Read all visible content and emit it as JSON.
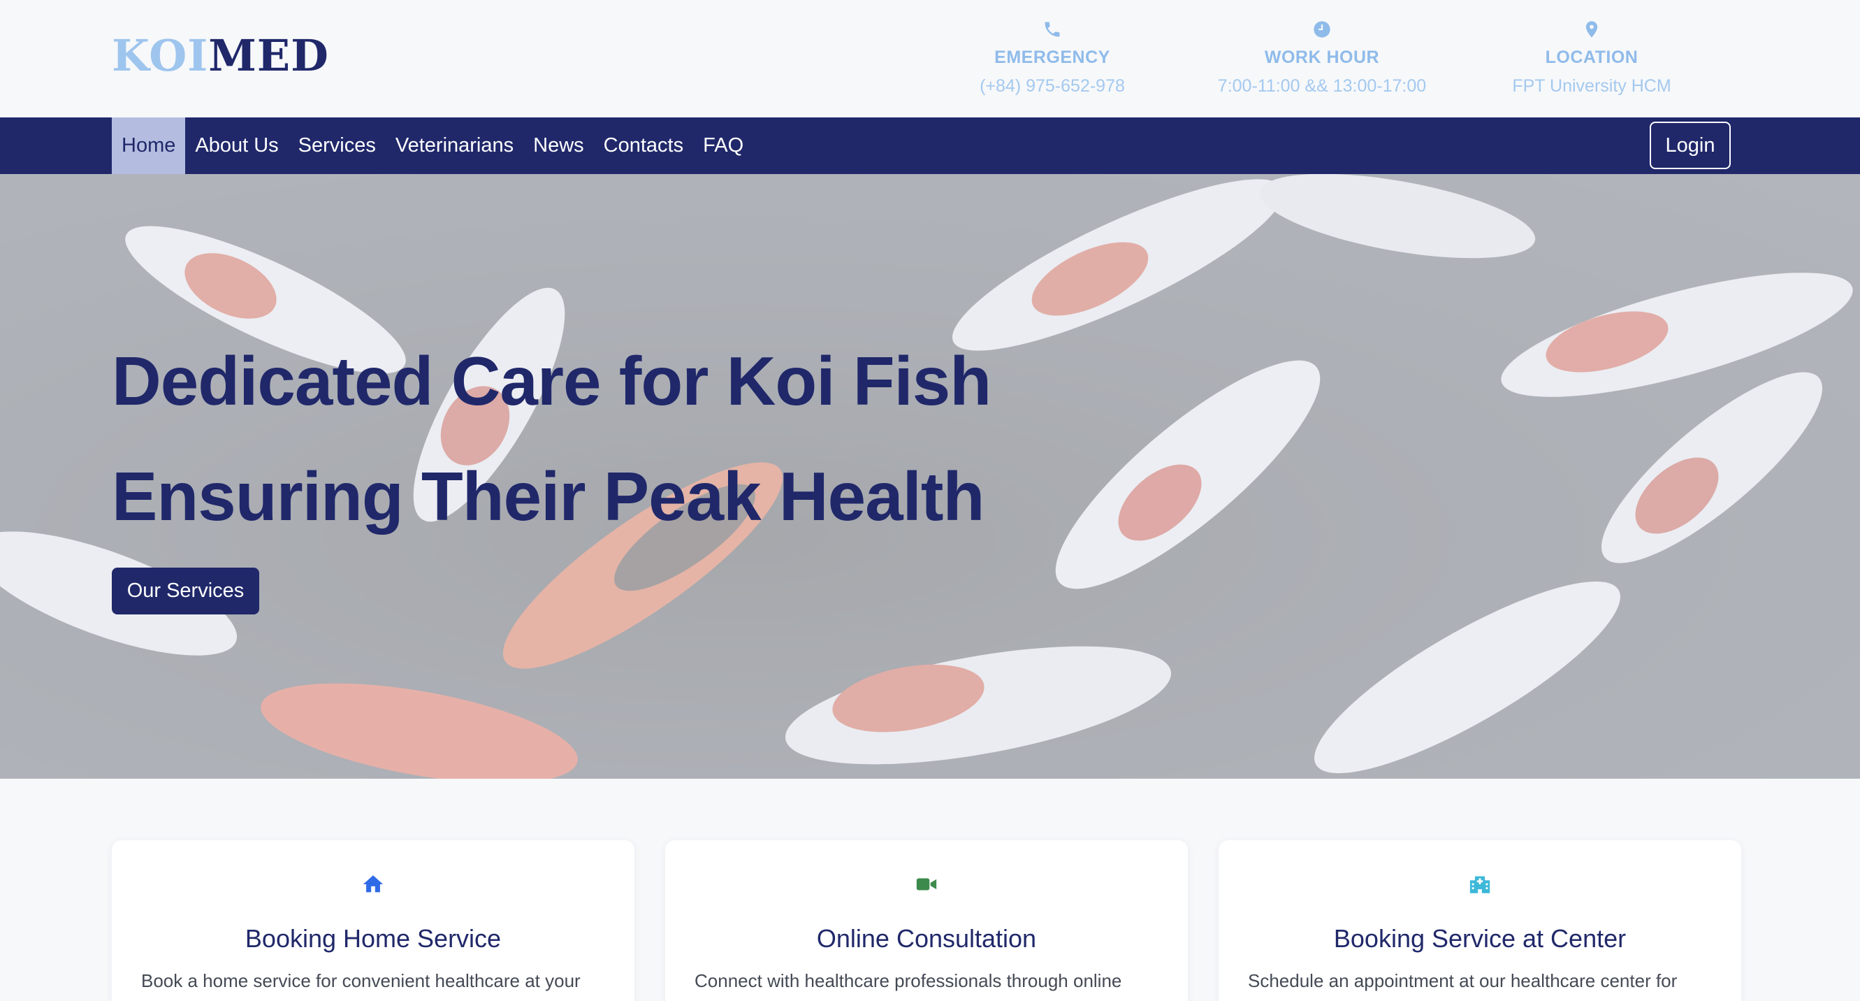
{
  "brand": {
    "part1": "KOI",
    "part2": "MED",
    "color_light": "#9ec5ee",
    "color_dark": "#20286a"
  },
  "header_info": [
    {
      "icon": "phone-icon",
      "label": "EMERGENCY",
      "value": "(+84) 975-652-978"
    },
    {
      "icon": "clock-icon",
      "label": "WORK HOUR",
      "value": "7:00-11:00 && 13:00-17:00"
    },
    {
      "icon": "location-pin-icon",
      "label": "LOCATION",
      "value": "FPT University HCM"
    }
  ],
  "nav": {
    "items": [
      {
        "label": "Home",
        "active": true
      },
      {
        "label": "About Us"
      },
      {
        "label": "Services"
      },
      {
        "label": "Veterinarians"
      },
      {
        "label": "News"
      },
      {
        "label": "Contacts"
      },
      {
        "label": "FAQ"
      }
    ],
    "login_label": "Login"
  },
  "hero": {
    "line1": "Dedicated Care for Koi Fish",
    "line2": "Ensuring Their Peak Health",
    "button_label": "Our Services"
  },
  "cards": [
    {
      "icon": "home-icon",
      "icon_color": "#2f6be6",
      "title": "Booking Home Service",
      "desc": "Book a home service for convenient healthcare at your"
    },
    {
      "icon": "video-camera-icon",
      "icon_color": "#3c8a4c",
      "title": "Online Consultation",
      "desc": "Connect with healthcare professionals through online"
    },
    {
      "icon": "hospital-icon",
      "icon_color": "#3cb8d8",
      "title": "Booking Service at Center",
      "desc": "Schedule an appointment at our healthcare center for"
    }
  ],
  "colors": {
    "navy": "#20286a",
    "accent_light": "#8fbbea",
    "page_bg": "#f7f8fa"
  }
}
